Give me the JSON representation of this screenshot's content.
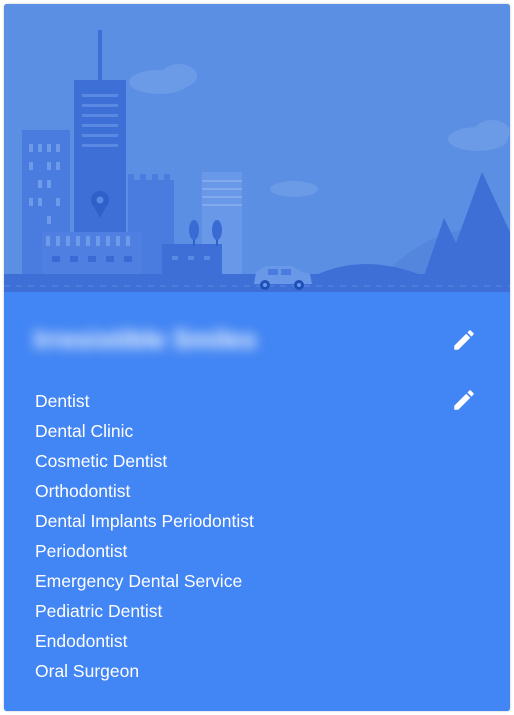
{
  "business": {
    "name": "Irresistible Smiles",
    "name_blurred": true
  },
  "categories": [
    "Dentist",
    "Dental Clinic",
    "Cosmetic Dentist",
    "Orthodontist",
    "Dental Implants Periodontist",
    "Periodontist",
    "Emergency Dental Service",
    "Pediatric Dentist",
    "Endodontist",
    "Oral Surgeon"
  ],
  "icons": {
    "edit_name": "pencil-icon",
    "edit_categories": "pencil-icon",
    "hero": "city-skyline-illustration"
  },
  "colors": {
    "card_background": "#4285f4",
    "hero_sky": "#5b8fe3",
    "text": "#ffffff"
  }
}
